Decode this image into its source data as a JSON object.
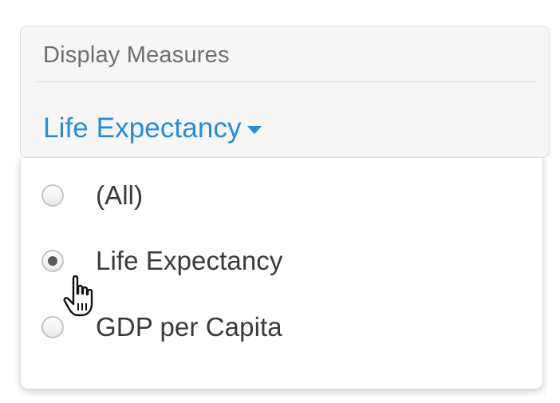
{
  "filter": {
    "title": "Display Measures",
    "selected_label": "Life Expectancy"
  },
  "dropdown": {
    "options": [
      {
        "label": "(All)",
        "checked": false
      },
      {
        "label": "Life Expectancy",
        "checked": true
      },
      {
        "label": "GDP per Capita",
        "checked": false
      }
    ]
  },
  "colors": {
    "accent": "#2a8bd6",
    "card_background": "#f6f6f6",
    "text_primary": "#3a3a3a",
    "text_secondary": "#6f6f6f"
  },
  "icons": {
    "caret": "caret-down-icon",
    "cursor": "hand-pointer-cursor-icon"
  }
}
